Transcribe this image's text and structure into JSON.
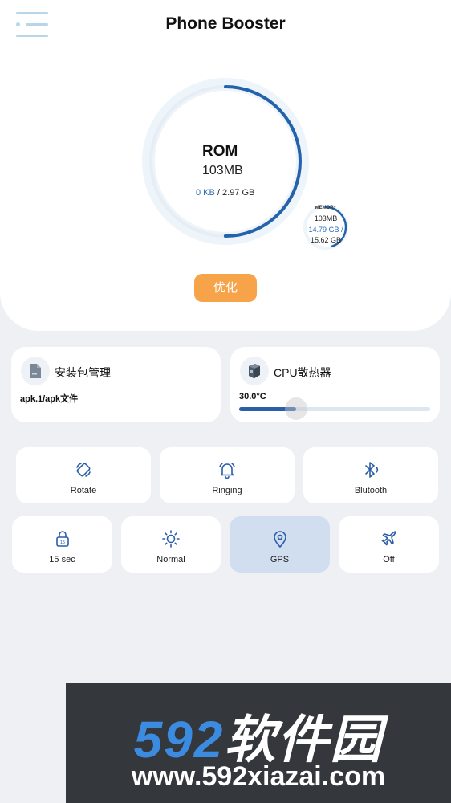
{
  "header": {
    "title": "Phone Booster",
    "menu_icon": "menu-icon"
  },
  "storage_gauge": {
    "label": "ROM",
    "value": "103MB",
    "used": "0 KB",
    "separator": " / ",
    "total": "2.97 GB",
    "fill_fraction": 0.5,
    "accent": "#2462ac",
    "ring_bg": "#edf4fa"
  },
  "memory_gauge": {
    "label": "MEMORY",
    "value": "103MB",
    "used": "14.79 GB /",
    "total": "15.62 GB",
    "fill_fraction": 0.45
  },
  "optimize_button": {
    "label": "优化",
    "color": "#f6a34a"
  },
  "cards": {
    "apk": {
      "title": "安装包管理",
      "subtitle": "apk.1/apk文件",
      "icon": "file-icon"
    },
    "cpu": {
      "title": "CPU散热器",
      "temperature": "30.0°C",
      "icon": "chip-icon",
      "slider_fraction": 0.3
    }
  },
  "toggles_row1": [
    {
      "label": "Rotate",
      "icon": "rotate-icon"
    },
    {
      "label": "Ringing",
      "icon": "bell-icon"
    },
    {
      "label": "Blutooth",
      "icon": "bluetooth-icon"
    }
  ],
  "toggles_row2": [
    {
      "label": "15 sec",
      "icon": "lock-icon"
    },
    {
      "label": "Normal",
      "icon": "brightness-icon"
    },
    {
      "label": "GPS",
      "icon": "location-icon",
      "active": true
    },
    {
      "label": "Off",
      "icon": "airplane-icon"
    }
  ],
  "watermark": {
    "number": "592",
    "text": "软件园",
    "url": "www.592xiazai.com"
  }
}
